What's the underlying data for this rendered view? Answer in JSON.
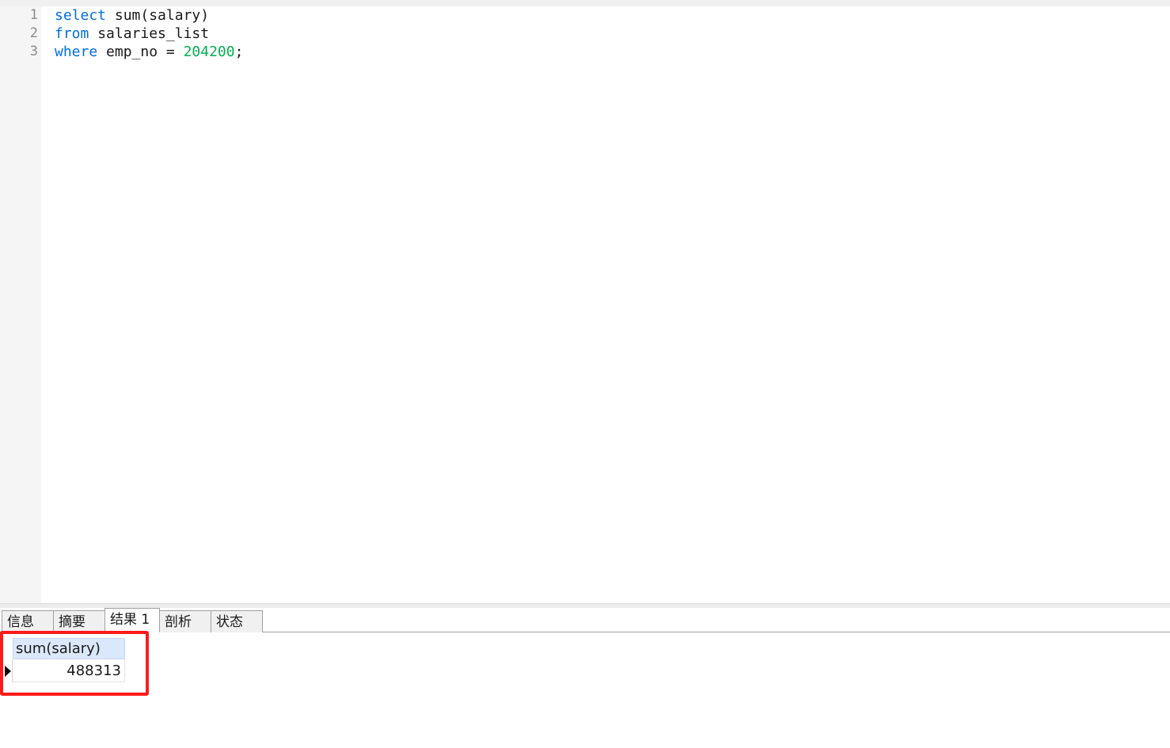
{
  "editor": {
    "line_numbers": [
      "1",
      "2",
      "3"
    ],
    "lines": [
      {
        "keyword": "select",
        "rest": " sum(salary)"
      },
      {
        "keyword": "from",
        "rest": " salaries_list"
      },
      {
        "keyword": "where",
        "rest": " emp_no = ",
        "number": "204200",
        "tail": ";"
      }
    ],
    "colors": {
      "keyword": "#0070e0",
      "number": "#00b050"
    }
  },
  "tabs": [
    {
      "label": "信息",
      "active": false
    },
    {
      "label": "摘要",
      "active": false
    },
    {
      "label": "结果 1",
      "active": true
    },
    {
      "label": "剖析",
      "active": false
    },
    {
      "label": "状态",
      "active": false
    }
  ],
  "result": {
    "columns": [
      "sum(salary)"
    ],
    "rows": [
      [
        "488313"
      ]
    ],
    "current_row_icon": "row-pointer-icon",
    "highlight_color": "#ff1a1a"
  }
}
